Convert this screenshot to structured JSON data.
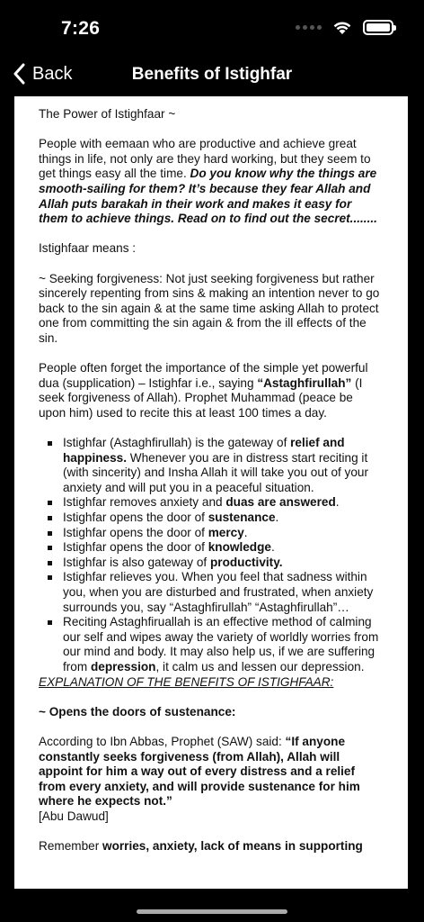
{
  "status": {
    "time": "7:26"
  },
  "nav": {
    "back_label": "Back",
    "title": "Benefits of Istighfar"
  },
  "article": {
    "intro_title": "The Power of Istighfaar ~",
    "para1_normal": "People with eemaan who are productive and achieve great things in life, not only are they hard working, but they seem to get things easy all the time. ",
    "para1_bold": "Do you know why the things are smooth-sailing for them? It’s because they fear Allah and Allah puts barakah in their work and makes it easy for them to achieve things. Read on to find out the secret........",
    "means_label": "Istighfaar means :",
    "seeking": "~ Seeking forgiveness:  Not just seeking forgiveness but rather sincerely repenting from sins & making an intention never to go back to the sin again & at the same time asking Allah to protect one from committing the sin again & from the ill effects of the sin.",
    "dua_a": "People often forget the importance of the simple yet powerful dua (supplication) – Istighfar i.e., saying ",
    "dua_bold": "“Astaghfirullah”",
    "dua_b": " (I seek forgiveness of Allah). Prophet Muhammad (peace be upon him) used to recite this at least 100 times a day.",
    "bullets": {
      "b1_a": "Istighfar (Astaghfirullah) is the gateway of ",
      "b1_bold": "relief and happiness.",
      "b1_b": " Whenever you are in distress start reciting it (with sincerity) and Insha Allah it will take you out of your anxiety and will put you in a peaceful situation.",
      "b2_a": "Istighfar removes anxiety and ",
      "b2_bold": "duas are answered",
      "b2_b": ".",
      "b3_a": "Istighfar opens the door of ",
      "b3_bold": "sustenance",
      "b3_b": ".",
      "b4_a": "Istighfar opens the door of ",
      "b4_bold": "mercy",
      "b4_b": ".",
      "b5_a": "Istighfar opens the door of ",
      "b5_bold": "knowledge",
      "b5_b": ".",
      "b6_a": "Istighfar is also gateway of ",
      "b6_bold": "productivity.",
      "b7": "Istighfar relieves you. When you feel that sadness within you, when you are disturbed and frustrated, when anxiety surrounds you, say “Astaghfirullah” “Astaghfirullah”…",
      "b8_a": "Reciting Astaghfiruallah is an effective method of calming our self and wipes away the variety of worldly worries from our mind and body. It may also help us, if we are suffering from ",
      "b8_bold": "depression",
      "b8_b": ", it calm us and lessen our depression."
    },
    "explanation_heading": "EXPLANATION OF THE BENEFITS OF ISTIGHFAAR:",
    "sustenance_heading": "~ Opens the doors of sustenance:",
    "ibn_abbas_a": "According to Ibn Abbas, Prophet (SAW) said: ",
    "ibn_abbas_bold": "“If anyone constantly seeks forgiveness (from Allah), Allah will appoint for him a way out of every distress and a relief from every anxiety, and will provide sustenance for him where he expects not.”",
    "source": "[Abu Dawud]",
    "remember_a": "Remember ",
    "remember_bold": "worries, anxiety, lack of means in supporting"
  }
}
